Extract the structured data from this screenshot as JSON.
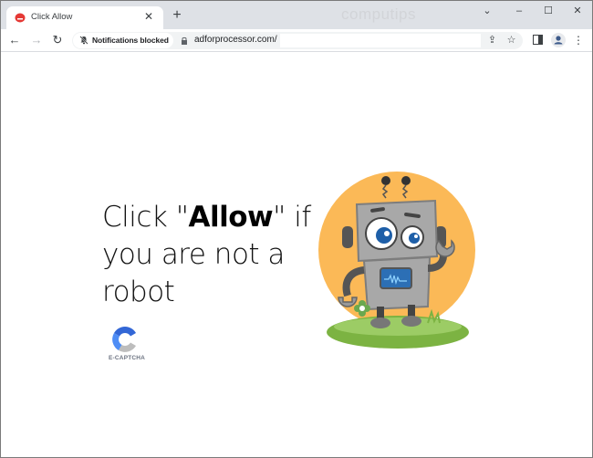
{
  "browser": {
    "tab": {
      "title": "Click Allow",
      "close_icon": "close-icon"
    },
    "new_tab_icon": "plus-icon",
    "watermark": "computips",
    "window_controls": {
      "tab_search": "⌄",
      "minimize": "–",
      "maximize": "☐",
      "close": "✕"
    },
    "toolbar": {
      "back": "←",
      "forward": "→",
      "reload": "↻",
      "notification_chip": "Notifications blocked",
      "url": "adforprocessor.com/",
      "share_icon": "⇪",
      "bookmark_icon": "☆",
      "side_panel_icon": "▮",
      "menu_icon": "⋮"
    }
  },
  "page": {
    "headline": {
      "part1": "Click \"",
      "emphasis": "Allow",
      "part2": "\" if you are not a robot"
    },
    "captcha_label": "E-CAPTCHA"
  },
  "colors": {
    "tabstrip": "#dee1e6",
    "sun": "#fbb957",
    "robot_body": "#a8a8a8",
    "eye_iris": "#1e5fa8",
    "grass": "#7cb342",
    "captcha_blue": "#3367d6",
    "captcha_lightblue": "#4e8df5",
    "captcha_gray": "#bdbdbd"
  }
}
